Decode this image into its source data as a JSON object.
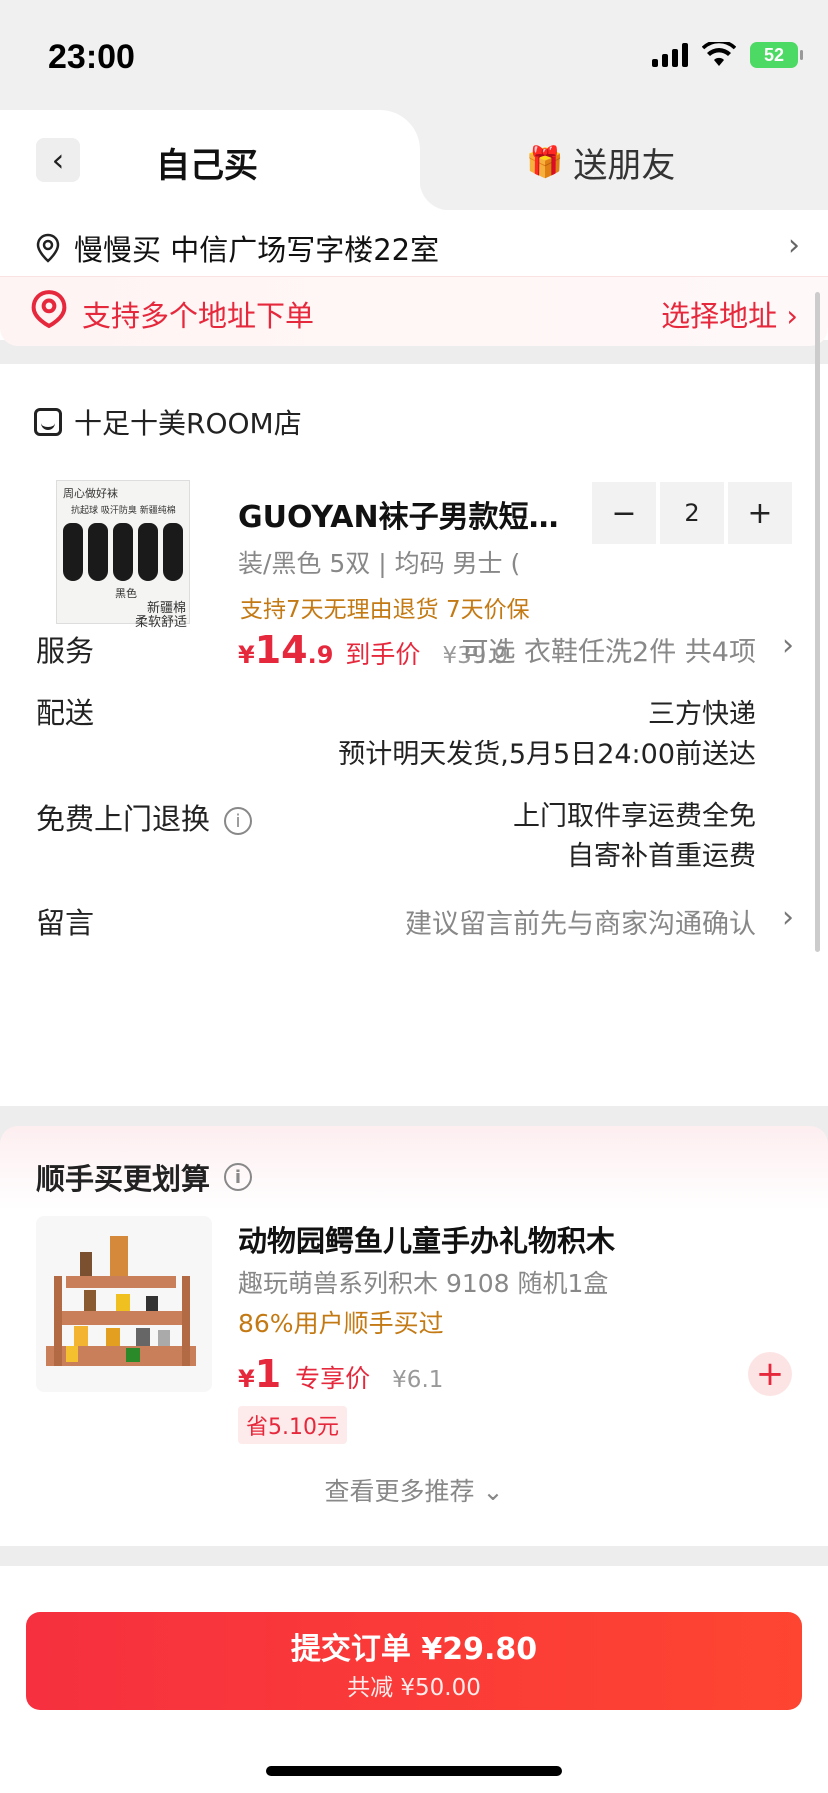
{
  "status_bar": {
    "time": "23:00",
    "battery": "52"
  },
  "tabs": {
    "self_buy": "自己买",
    "gift": "送朋友",
    "gift_icon": "gift-icon"
  },
  "address": {
    "text": "慢慢买  中信广场写字楼22室",
    "multi_label": "支持多个地址下单",
    "select_label": "选择地址 ›"
  },
  "shop": {
    "name": "十足十美ROOM店"
  },
  "product": {
    "image_top_text": "周心做好袜",
    "image_tag": "抗起球   吸汗防臭   新疆纯棉",
    "image_color": "黑色",
    "image_slogan_1": "新疆棉",
    "image_slogan_2": "柔软舒适",
    "title": "GUOYAN袜子男款短…",
    "spec": "装/黑色 5双  |  均码 男士 (",
    "tags": "支持7天无理由退货   7天价保",
    "price_symbol": "¥",
    "price_int": "14",
    "price_dec": ".9",
    "price_label": "到手价",
    "original_price": "¥39.9",
    "quantity": "2",
    "minus": "−",
    "plus": "+"
  },
  "rows": {
    "service_label": "服务",
    "service_value": "可选 衣鞋任洗2件 共4项",
    "delivery_label": "配送",
    "delivery_value_1": "三方快递",
    "delivery_value_2": "预计明天发货,5月5日24:00前送达",
    "return_label": "免费上门退换",
    "return_value_1": "上门取件享运费全免",
    "return_value_2": "自寄补首重运费",
    "message_label": "留言",
    "message_value": "建议留言前先与商家沟通确认"
  },
  "recommend": {
    "title": "顺手买更划算",
    "name": "动物园鳄鱼儿童手办礼物积木",
    "spec": "趣玩萌兽系列积木 9108 随机1盒",
    "bought": "86%用户顺手买过",
    "price_symbol": "¥",
    "price": "1",
    "price_label": "专享价",
    "original_price": "¥6.1",
    "save": "省5.10元",
    "more": "查看更多推荐 ⌄"
  },
  "submit": {
    "main": "提交订单 ¥29.80",
    "sub": "共减 ¥50.00"
  },
  "colors": {
    "accent": "#e6283c",
    "orange": "#c47a14"
  }
}
